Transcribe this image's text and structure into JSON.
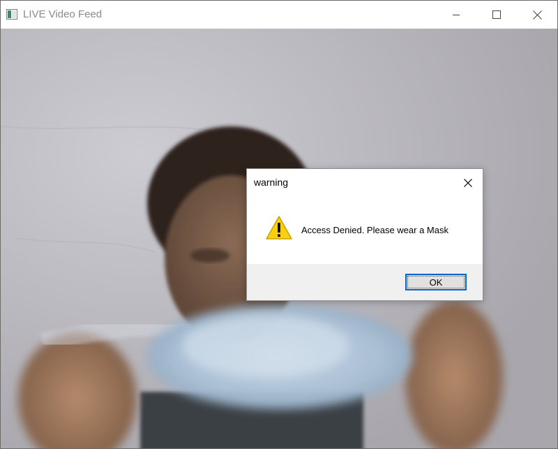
{
  "window": {
    "title": "LIVE Video Feed",
    "icon": "app-window-icon",
    "controls": [
      "minimize-icon",
      "maximize-icon",
      "close-icon"
    ]
  },
  "video": {
    "content": "live-camera-feed"
  },
  "dialog": {
    "title": "warning",
    "icon": "warning-triangle-icon",
    "message": "Access Denied. Please wear a Mask",
    "ok_label": "OK",
    "close_icon": "close-icon"
  },
  "colors": {
    "title_text": "#8a8a8a",
    "ok_border": "#0a64c8",
    "warning_yellow": "#f8d010",
    "dialog_footer": "#f0f0f0"
  }
}
